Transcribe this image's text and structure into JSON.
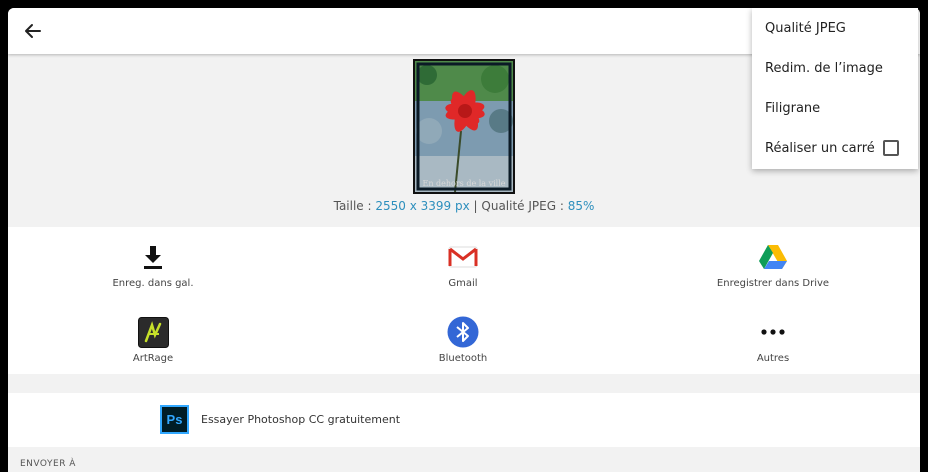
{
  "preview": {
    "watermark_text": "En dehors de la ville"
  },
  "info": {
    "size_label": "Taille : ",
    "size_value": "2550 x 3399 px",
    "separator": " | ",
    "quality_label": "Qualité JPEG : ",
    "quality_value": "85%"
  },
  "share": {
    "items": [
      {
        "label": "Enreg. dans gal.",
        "icon": "download-icon"
      },
      {
        "label": "Gmail",
        "icon": "gmail-icon"
      },
      {
        "label": "Enregistrer dans Drive",
        "icon": "google-drive-icon"
      },
      {
        "label": "ArtRage",
        "icon": "artrage-icon"
      },
      {
        "label": "Bluetooth",
        "icon": "bluetooth-icon"
      },
      {
        "label": "Autres",
        "icon": "more-horizontal-icon"
      }
    ]
  },
  "promo": {
    "icon_text": "Ps",
    "label": "Essayer Photoshop CC gratuitement"
  },
  "footer": {
    "label": "ENVOYER À"
  },
  "menu": {
    "items": [
      {
        "label": "Qualité JPEG"
      },
      {
        "label": "Redim. de l’image"
      },
      {
        "label": "Filigrane"
      },
      {
        "label": "Réaliser un carré",
        "checked": false
      }
    ]
  },
  "colors": {
    "accent": "#2d8fbd",
    "photoshop_blue": "#31a8ff",
    "bluetooth_blue": "#3367d6"
  }
}
